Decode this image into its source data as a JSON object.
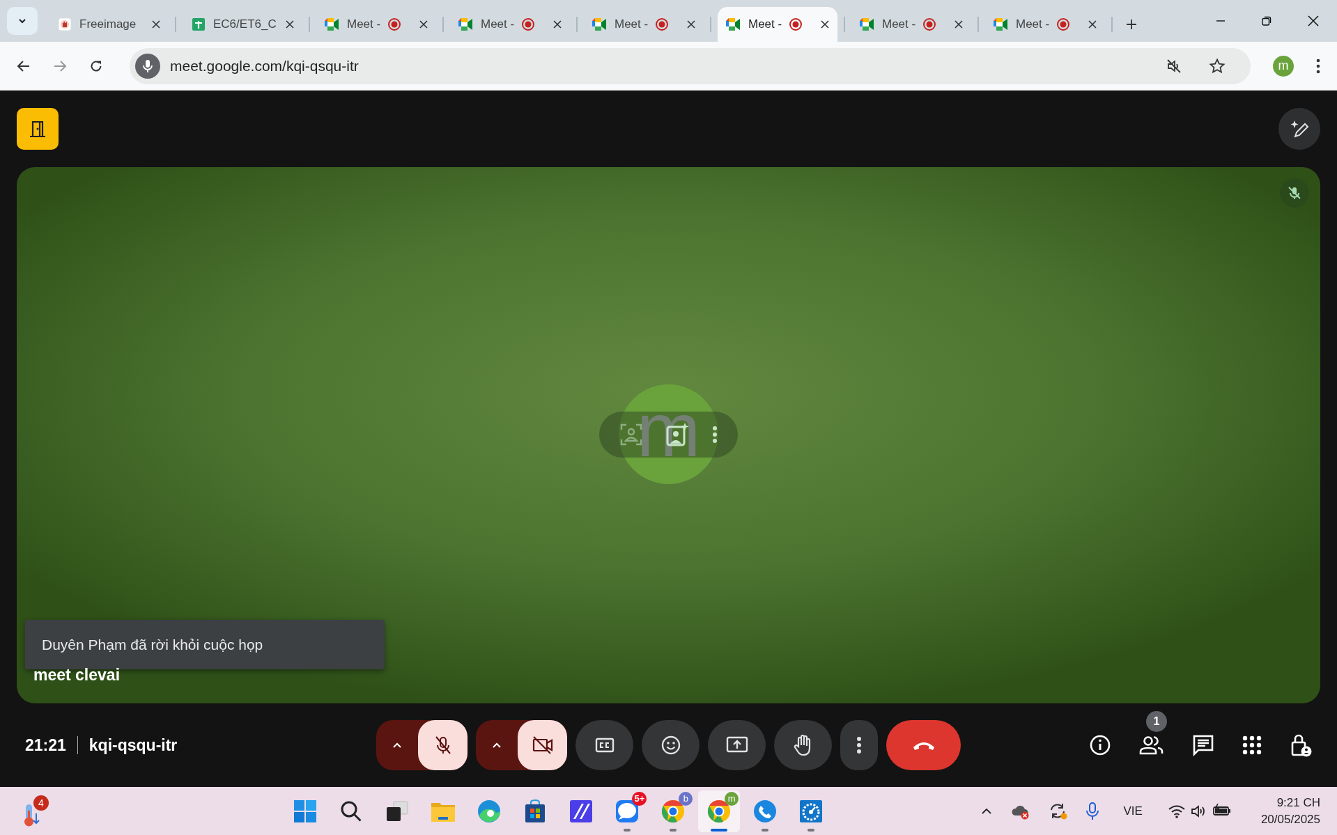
{
  "tabs": [
    {
      "kind": "freeimages",
      "title": "Freeimage",
      "recording": false,
      "selected": false
    },
    {
      "kind": "sheets",
      "title": "EC6/ET6_C",
      "recording": false,
      "selected": false
    },
    {
      "kind": "meet",
      "title": "Meet -",
      "recording": true,
      "selected": false
    },
    {
      "kind": "meet",
      "title": "Meet -",
      "recording": true,
      "selected": false
    },
    {
      "kind": "meet",
      "title": "Meet -",
      "recording": true,
      "selected": false
    },
    {
      "kind": "meet",
      "title": "Meet -",
      "recording": true,
      "selected": true
    },
    {
      "kind": "meet",
      "title": "Meet -",
      "recording": true,
      "selected": false
    },
    {
      "kind": "meet",
      "title": "Meet -",
      "recording": true,
      "selected": false
    }
  ],
  "address_bar": {
    "url": "meet.google.com/kqi-qsqu-itr",
    "profile": "m"
  },
  "tile": {
    "avatar_letter": "m",
    "participant_name": "meet clevai",
    "muted": true
  },
  "toast": {
    "text": "Duyên Phạm đã rời khỏi cuộc họp"
  },
  "meeting_bar": {
    "time": "21:21",
    "code": "kqi-qsqu-itr",
    "mic_on": false,
    "camera_on": false,
    "people_count": "1"
  },
  "taskbar": {
    "weather_badge": "4",
    "apps": [
      {
        "kind": "start",
        "running": false,
        "selected": false
      },
      {
        "kind": "search",
        "running": false,
        "selected": false
      },
      {
        "kind": "taskview",
        "running": false,
        "selected": false
      },
      {
        "kind": "files",
        "running": false,
        "selected": false
      },
      {
        "kind": "edge",
        "running": false,
        "selected": false
      },
      {
        "kind": "store",
        "running": false,
        "selected": false
      },
      {
        "kind": "editor",
        "running": false,
        "selected": false
      },
      {
        "kind": "zalo",
        "badge": "5+",
        "running": true,
        "selected": false
      },
      {
        "kind": "chrome",
        "badge": "b",
        "running": true,
        "selected": false
      },
      {
        "kind": "chrome",
        "badge": "m",
        "running": true,
        "selected": true
      },
      {
        "kind": "phone",
        "running": true,
        "selected": false
      },
      {
        "kind": "speed",
        "running": true,
        "selected": false
      }
    ],
    "language": "VIE",
    "clock": "9:21 CH",
    "date": "20/05/2025"
  }
}
